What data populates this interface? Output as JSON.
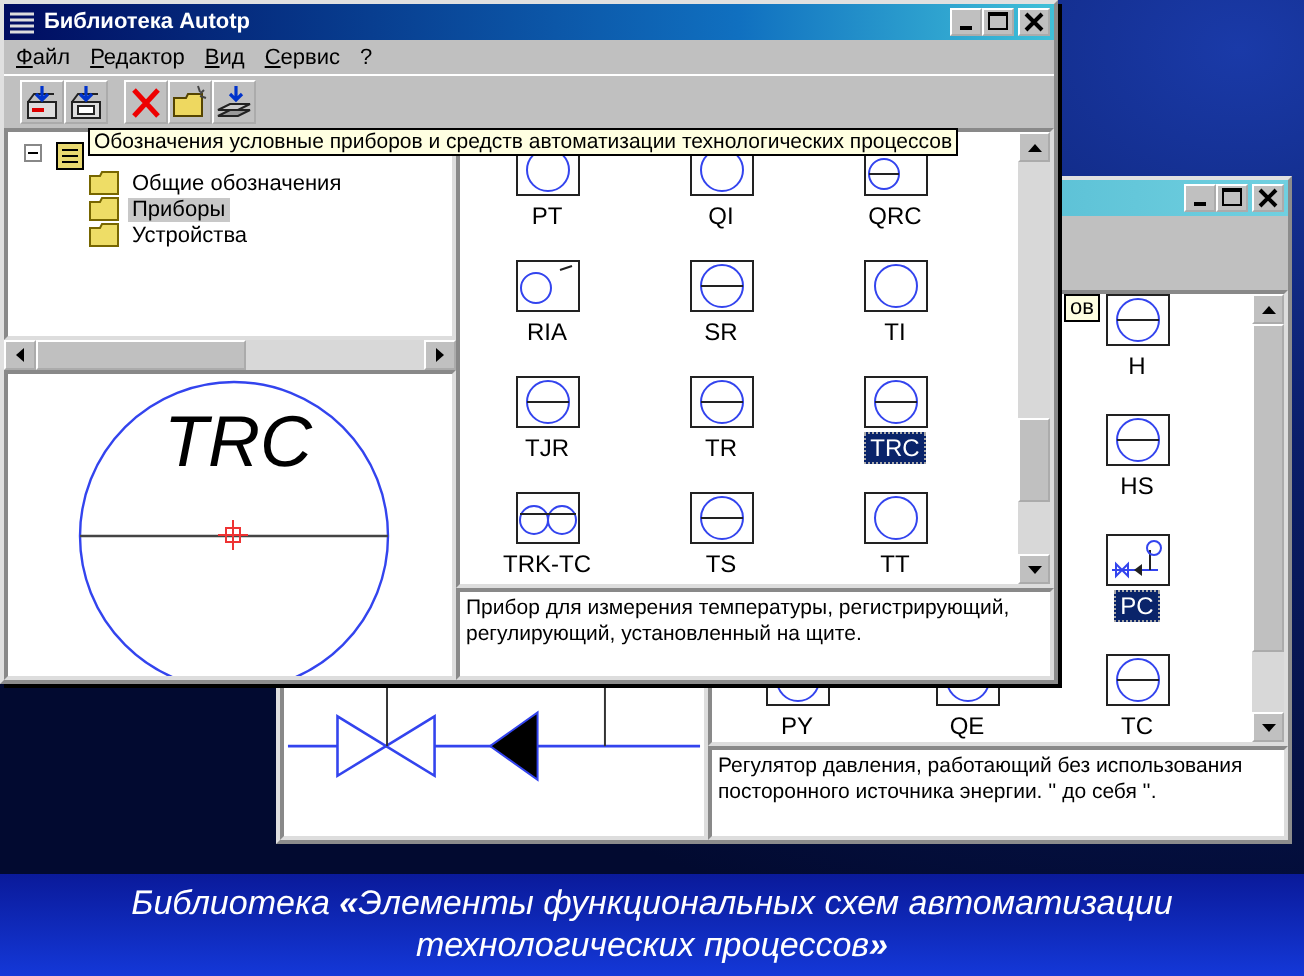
{
  "back_window": {
    "tooltip_fragment": "ов",
    "right_column": [
      {
        "label": "H",
        "kind": "split",
        "selected": false
      },
      {
        "label": "HS",
        "kind": "split",
        "selected": false
      },
      {
        "label": "PC",
        "kind": "valve",
        "selected": true
      }
    ],
    "bottom_row": [
      {
        "label": "PY",
        "kind": "plain",
        "selected": false
      },
      {
        "label": "QE",
        "kind": "plain",
        "selected": false
      },
      {
        "label": "TC",
        "kind": "split",
        "selected": false
      }
    ],
    "description": "Регулятор давления, работающий без использования посторонного источника энергии. '' до себя ''."
  },
  "front_window": {
    "title": "Библиотека Autotp",
    "menu": [
      "Файл",
      "Редактор",
      "Вид",
      "Сервис",
      "?"
    ],
    "tree": {
      "expanded": true,
      "children": [
        {
          "label": "Общие обозначения",
          "selected": false
        },
        {
          "label": "Приборы",
          "selected": true
        },
        {
          "label": "Устройства",
          "selected": false
        }
      ]
    },
    "tooltip": "Обозначения условные приборов и средств автоматизации технологических процессов",
    "preview_label": "TRC",
    "symbols": [
      {
        "label": "PT",
        "kind": "plain",
        "selected": false
      },
      {
        "label": "QI",
        "kind": "plain",
        "selected": false
      },
      {
        "label": "QRC",
        "kind": "offset-split",
        "selected": false
      },
      {
        "label": "RIA",
        "kind": "offset",
        "selected": false
      },
      {
        "label": "SR",
        "kind": "split",
        "selected": false
      },
      {
        "label": "TI",
        "kind": "plain",
        "selected": false
      },
      {
        "label": "TJR",
        "kind": "split",
        "selected": false
      },
      {
        "label": "TR",
        "kind": "split",
        "selected": false
      },
      {
        "label": "TRC",
        "kind": "split",
        "selected": true
      },
      {
        "label": "TRK-TC",
        "kind": "double",
        "selected": false
      },
      {
        "label": "TS",
        "kind": "split",
        "selected": false
      },
      {
        "label": "TT",
        "kind": "plain",
        "selected": false
      }
    ],
    "description": "Прибор для измерения температуры, регистрирующий, регулирующий, установленный на щите."
  },
  "caption": "Библиотека **«**Элементы функциональных схем автоматизации технологических процессов**»**"
}
